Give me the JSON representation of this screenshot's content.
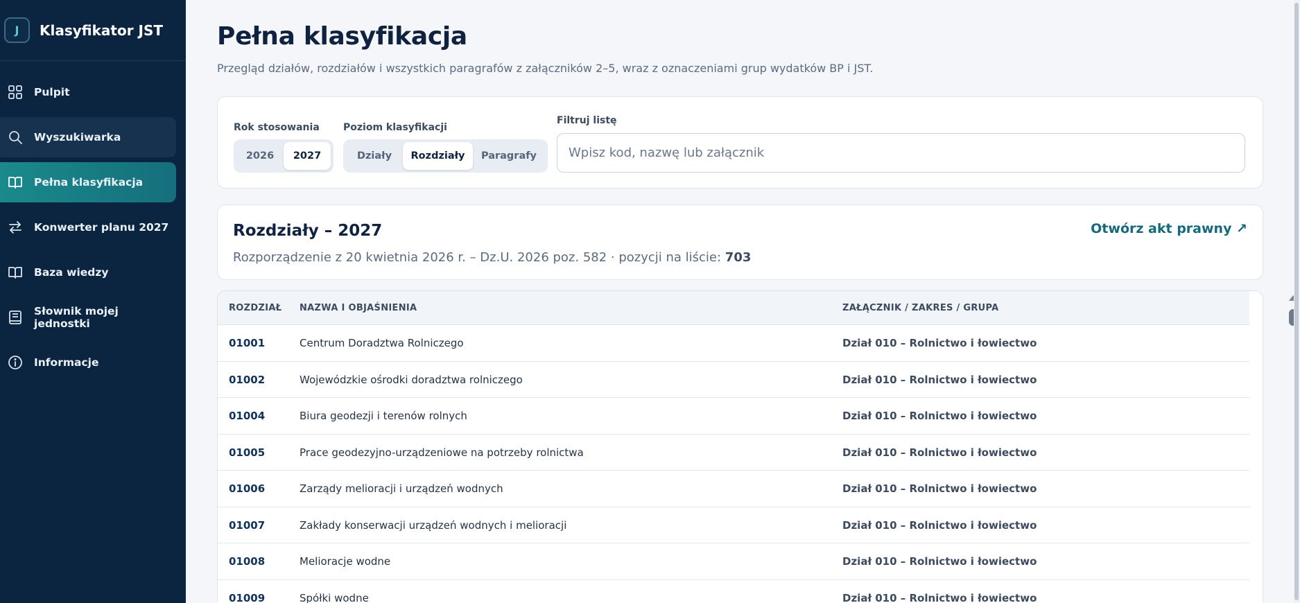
{
  "sidebar": {
    "brand_initial": "J",
    "brand_title": "Klasyfikator JST",
    "items": [
      {
        "label": "Pulpit",
        "icon": "grid-icon"
      },
      {
        "label": "Wyszukiwarka",
        "icon": "search-icon"
      },
      {
        "label": "Pełna klasyfikacja",
        "icon": "book-open-icon"
      },
      {
        "label": "Konwerter planu 2027",
        "icon": "swap-arrows-icon"
      },
      {
        "label": "Baza wiedzy",
        "icon": "book-open-icon"
      },
      {
        "label": "Słownik mojej jednostki",
        "icon": "notebook-icon"
      },
      {
        "label": "Informacje",
        "icon": "info-circle-icon"
      }
    ],
    "active_index": 2,
    "hover_index": 1
  },
  "header": {
    "title": "Pełna klasyfikacja",
    "description": "Przegląd działów, rozdziałów i wszystkich paragrafów z załączników 2–5, wraz z oznaczeniami grup wydatków BP i JST."
  },
  "filters": {
    "year_label": "Rok stosowania",
    "years": [
      "2026",
      "2027"
    ],
    "selected_year": "2027",
    "level_label": "Poziom klasyfikacji",
    "levels": [
      "Działy",
      "Rozdziały",
      "Paragrafy"
    ],
    "selected_level": "Rozdziały",
    "filter_label": "Filtruj listę",
    "filter_placeholder": "Wpisz kod, nazwę lub załącznik",
    "filter_value": ""
  },
  "section": {
    "title": "Rozdziały – 2027",
    "meta_prefix": "Rozporządzenie z 20 kwietnia 2026 r. – Dz.U. 2026 poz. 582 · pozycji na liście: ",
    "count": "703",
    "link_label": "Otwórz akt prawny ↗"
  },
  "table": {
    "columns": [
      "ROZDZIAŁ",
      "NAZWA I OBJAŚNIENIA",
      "ZAŁĄCZNIK / ZAKRES / GRUPA"
    ],
    "rows": [
      {
        "code": "01001",
        "name": "Centrum Doradztwa Rolniczego",
        "group": "Dział 010 – Rolnictwo i łowiectwo"
      },
      {
        "code": "01002",
        "name": "Wojewódzkie ośrodki doradztwa rolniczego",
        "group": "Dział 010 – Rolnictwo i łowiectwo"
      },
      {
        "code": "01004",
        "name": "Biura geodezji i terenów rolnych",
        "group": "Dział 010 – Rolnictwo i łowiectwo"
      },
      {
        "code": "01005",
        "name": "Prace geodezyjno-urządzeniowe na potrzeby rolnictwa",
        "group": "Dział 010 – Rolnictwo i łowiectwo"
      },
      {
        "code": "01006",
        "name": "Zarządy melioracji i urządzeń wodnych",
        "group": "Dział 010 – Rolnictwo i łowiectwo"
      },
      {
        "code": "01007",
        "name": "Zakłady konserwacji urządzeń wodnych i melioracji",
        "group": "Dział 010 – Rolnictwo i łowiectwo"
      },
      {
        "code": "01008",
        "name": "Melioracje wodne",
        "group": "Dział 010 – Rolnictwo i łowiectwo"
      },
      {
        "code": "01009",
        "name": "Spółki wodne",
        "group": "Dział 010 – Rolnictwo i łowiectwo"
      }
    ]
  },
  "colors": {
    "sidebar_bg": "#0b2540",
    "active_accent": "#1a8a8c",
    "link": "#146a7c"
  }
}
